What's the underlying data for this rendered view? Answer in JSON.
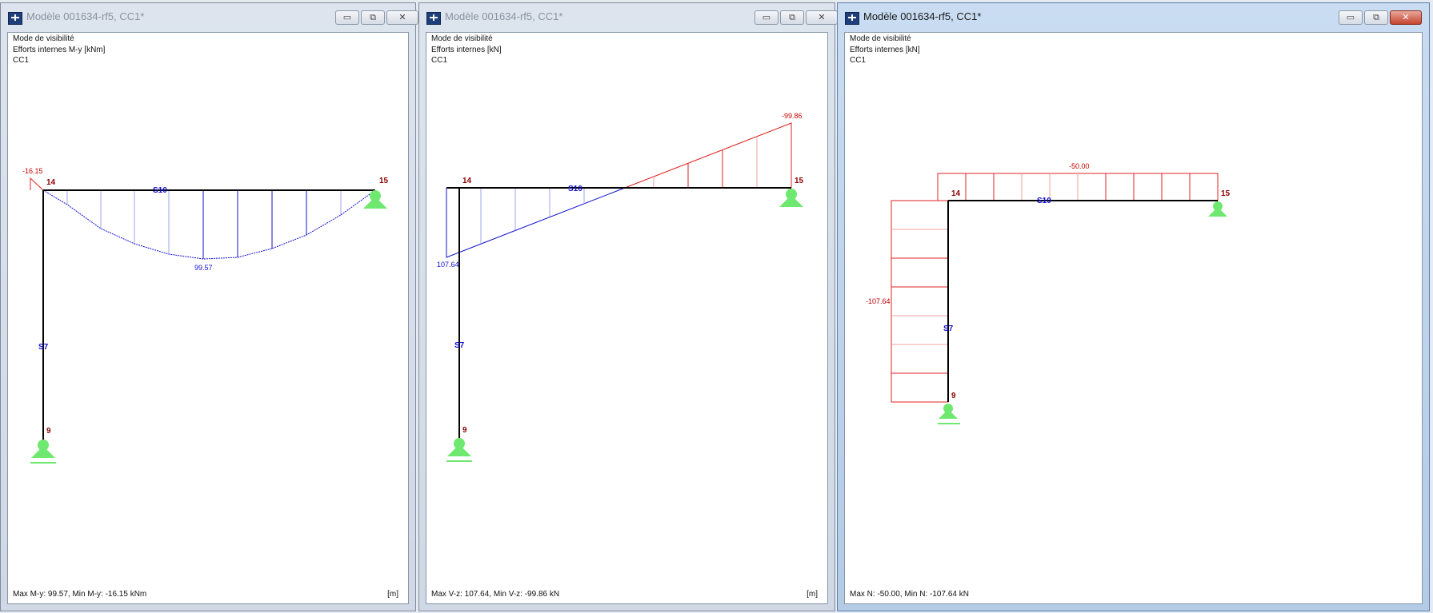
{
  "windows": [
    {
      "title": "Modèle 001634-rf5, CC1*",
      "visibility_mode": "Mode de visibilité",
      "result_label": "Efforts internes M-y [kNm]",
      "load_case": "CC1",
      "footer": "Max M-y: 99.57, Min M-y: -16.15 kNm",
      "unit": "[m]",
      "labels": {
        "node_top_left": "14",
        "node_top_right": "15",
        "node_bottom": "9",
        "member_beam": "S10",
        "member_column": "S7",
        "min_value": "-16.15",
        "max_value": "99.57"
      }
    },
    {
      "title": "Modèle 001634-rf5, CC1*",
      "visibility_mode": "Mode de visibilité",
      "result_label": "Efforts internes [kN]",
      "load_case": "CC1",
      "footer": "Max V-z: 107.64, Min V-z: -99.86 kN",
      "unit": "[m]",
      "labels": {
        "node_top_left": "14",
        "node_top_right": "15",
        "node_bottom": "9",
        "member_beam": "S10",
        "member_column": "S7",
        "min_value": "-99.86",
        "max_value": "107.64"
      }
    },
    {
      "title": "Modèle 001634-rf5, CC1*",
      "visibility_mode": "Mode de visibilité",
      "result_label": "Efforts internes [kN]",
      "load_case": "CC1",
      "footer": "Max N: -50.00, Min N: -107.64 kN",
      "unit": "",
      "labels": {
        "node_top_left": "14",
        "node_top_right": "15",
        "node_bottom": "9",
        "member_beam": "S10",
        "member_column": "S7",
        "beam_value": "-50.00",
        "column_value": "-107.64"
      }
    }
  ],
  "window_buttons": {
    "minimize": "▭",
    "restore": "⧉",
    "close": "✕"
  },
  "colors": {
    "positive": "#1010d0",
    "negative": "#e02020",
    "support": "#6ee86e",
    "structure": "#000000"
  }
}
